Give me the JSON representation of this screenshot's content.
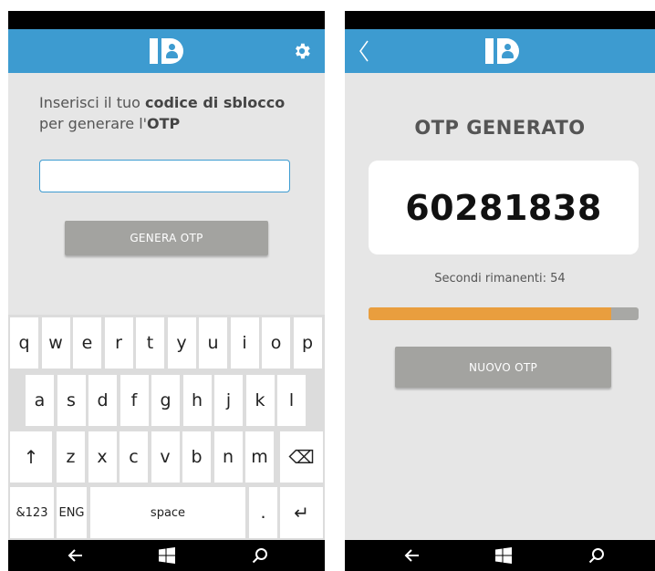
{
  "left_screen": {
    "prompt": {
      "part1": "Inserisci il tuo ",
      "bold1": "codice di sblocco",
      "part2": "per generare l'",
      "bold2": "OTP"
    },
    "input": {
      "value": "",
      "placeholder": ""
    },
    "generate_button": "GENERA OTP",
    "keyboard": {
      "row1": [
        "q",
        "w",
        "e",
        "r",
        "t",
        "y",
        "u",
        "i",
        "o",
        "p"
      ],
      "row2": [
        "a",
        "s",
        "d",
        "f",
        "g",
        "h",
        "j",
        "k",
        "l"
      ],
      "row3": [
        "z",
        "x",
        "c",
        "v",
        "b",
        "n",
        "m"
      ],
      "shift_symbol": "↑",
      "backspace_symbol": "⌫",
      "numbers_label": "&123",
      "language_label": "ENG",
      "space_label": "space",
      "period_label": ".",
      "enter_symbol": "↵"
    }
  },
  "right_screen": {
    "title": "OTP GENERATO",
    "otp_code": "60281838",
    "seconds_label": "Secondi rimanenti: 54",
    "progress_fraction": 0.9,
    "new_button": "NUOVO OTP"
  },
  "nav": {
    "back_symbol": "←",
    "search_icon": "search-icon",
    "windows_icon": "windows-logo-icon"
  },
  "colors": {
    "appbar": "#3d9bd0",
    "progress_fill": "#e99e3e",
    "progress_track": "#a8a8a5",
    "button_gray": "#a3a3a0"
  }
}
